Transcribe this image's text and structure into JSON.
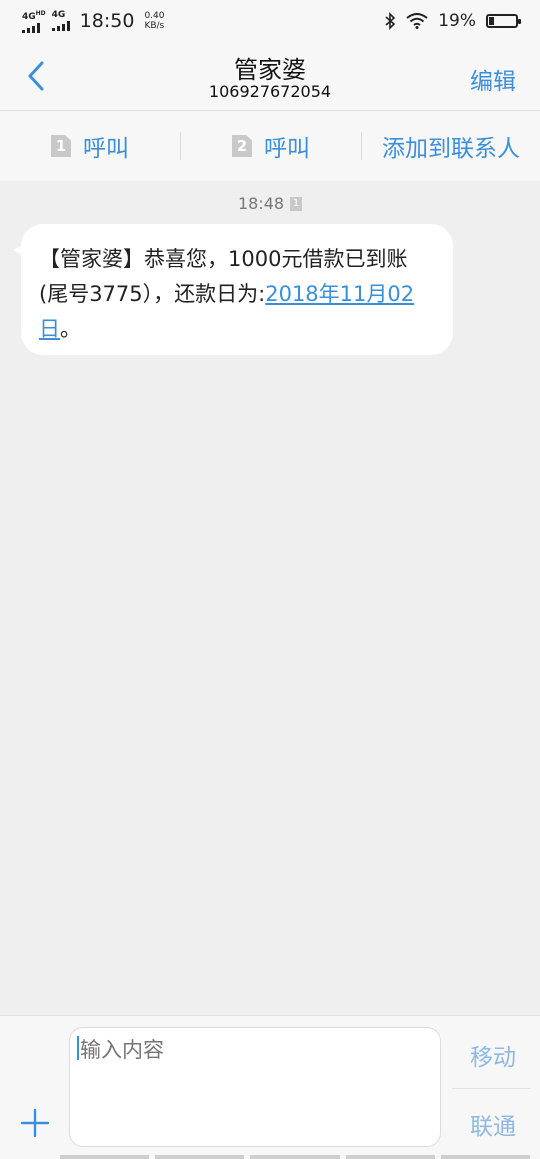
{
  "status_bar": {
    "network_1": "4G",
    "network_1_sub": "HD",
    "network_2": "4G",
    "time": "18:50",
    "speed_value": "0.40",
    "speed_unit": "KB/s",
    "battery_percent": "19%",
    "battery_level": 0.19,
    "icons": [
      "signal-icon",
      "bluetooth-icon",
      "wifi-icon",
      "battery-icon"
    ]
  },
  "header": {
    "title": "管家婆",
    "number": "106927672054",
    "edit_label": "编辑"
  },
  "actions": {
    "call_sim1_badge": "1",
    "call_sim1_label": "呼叫",
    "call_sim2_badge": "2",
    "call_sim2_label": "呼叫",
    "add_contact_label": "添加到联系人"
  },
  "conversation": {
    "timestamp": "18:48",
    "sim_badge": "1",
    "message_text": "【管家婆】恭喜您，1000元借款已到账(尾号3775），还款日为:",
    "message_link": "2018年11月02日",
    "message_end": "。"
  },
  "composer": {
    "placeholder": "输入内容",
    "carrier_1": "移动",
    "carrier_2": "联通"
  },
  "colors": {
    "accent": "#3b8fd9",
    "background": "#efefef",
    "bubble": "#ffffff"
  }
}
